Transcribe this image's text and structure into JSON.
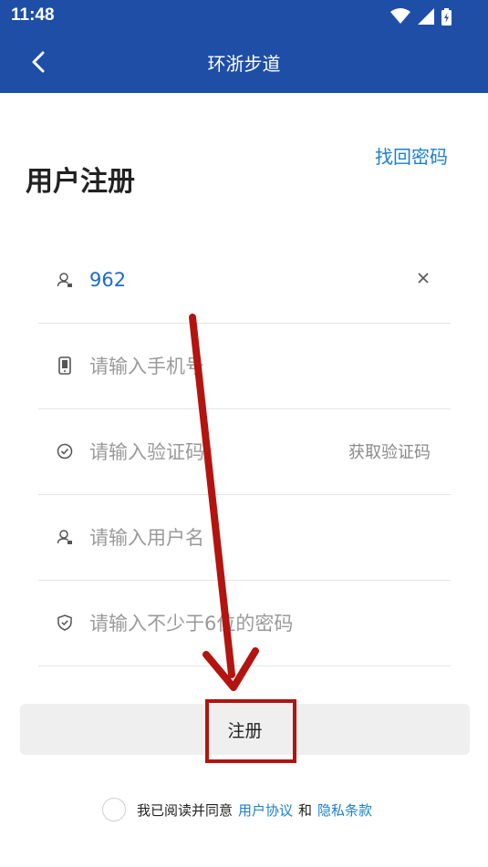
{
  "status": {
    "time": "11:48"
  },
  "appbar": {
    "title": "环浙步道"
  },
  "header": {
    "page_title": "用户注册",
    "forgot_link": "找回密码"
  },
  "form": {
    "account": {
      "value": "962"
    },
    "phone": {
      "placeholder": "请输入手机号"
    },
    "code": {
      "placeholder": "请输入验证码",
      "get_code": "获取验证码"
    },
    "username": {
      "placeholder": "请输入用户名"
    },
    "password": {
      "placeholder": "请输入不少于6位的密码"
    }
  },
  "register_button": "注册",
  "agreement": {
    "prefix": "我已阅读并同意",
    "user_agreement": "用户协议",
    "and": "和",
    "privacy": "隐私条款"
  },
  "colors": {
    "primary": "#1f4ea6",
    "link": "#1a7fd1",
    "annotation": "#b3140f"
  }
}
